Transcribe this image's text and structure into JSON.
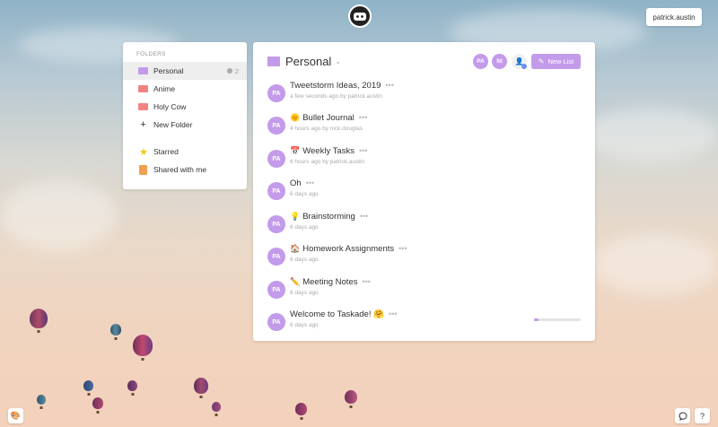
{
  "header": {
    "user_button": "patrick.austin"
  },
  "sidebar": {
    "label": "FOLDERS",
    "folders": [
      {
        "label": "Personal",
        "count": "2",
        "color": "#c39bea",
        "active": true
      },
      {
        "label": "Anime",
        "color": "#f38383"
      },
      {
        "label": "Holy Cow",
        "color": "#f38383"
      }
    ],
    "new_folder": "New Folder",
    "starred": "Starred",
    "shared": "Shared with me"
  },
  "main": {
    "title": "Personal",
    "members": [
      "PA",
      "NI"
    ],
    "new_list": "New List",
    "lists": [
      {
        "avatar": "PA",
        "emoji": "",
        "title": "Tweetstorm Ideas, 2019",
        "meta": "a few seconds ago by patrick.austin"
      },
      {
        "avatar": "PA",
        "emoji": "🌞",
        "title": "Bullet Journal",
        "meta": "4 hours ago by nick.douglas"
      },
      {
        "avatar": "PA",
        "emoji": "📅",
        "title": "Weekly Tasks",
        "meta": "6 hours ago by patrick.austin"
      },
      {
        "avatar": "PA",
        "emoji": "",
        "title": "Oh",
        "meta": "6 days ago"
      },
      {
        "avatar": "PA",
        "emoji": "💡",
        "title": "Brainstorming",
        "meta": "6 days ago"
      },
      {
        "avatar": "PA",
        "emoji": "🏠",
        "title": "Homework Assignments",
        "meta": "6 days ago"
      },
      {
        "avatar": "PA",
        "emoji": "✏️",
        "title": "Meeting Notes",
        "meta": "6 days ago"
      },
      {
        "avatar": "PA",
        "emoji": "",
        "title": "Welcome to Taskade! 🤗",
        "meta": "6 days ago",
        "progress": 0.1
      }
    ]
  },
  "footer": {
    "help": "?"
  },
  "colors": {
    "accent": "#c39bea",
    "folder_red": "#f38383"
  }
}
